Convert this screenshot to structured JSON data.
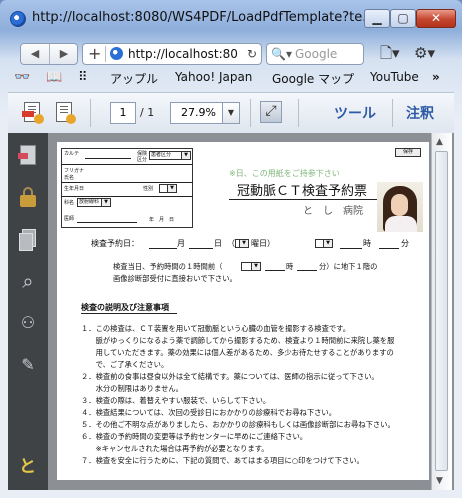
{
  "window": {
    "title": "http://localhost:8080/WS4PDF/LoadPdfTemplate?te..."
  },
  "address_bar": {
    "url": "http://localhost:80"
  },
  "search": {
    "placeholder": "Google"
  },
  "bookmarks": [
    "アップル",
    "Yahoo! Japan",
    "Google マップ",
    "YouTube"
  ],
  "pdf_toolbar": {
    "page_current": "1",
    "page_total": "/ 1",
    "zoom": "27.9%",
    "tools_label": "ツール",
    "comment_label": "注釈"
  },
  "sidebar": {
    "bottom_char": "と"
  },
  "document": {
    "form_labels": {
      "karte": "カルテ",
      "hoken_kind": "保険",
      "kubun": "区分",
      "furigana": "フリガナ",
      "name": "氏名",
      "birthday": "生年月日",
      "gender": "性別",
      "ward": "科名",
      "doctor": "医師",
      "date_suffix": "年　月　日",
      "hoken_value": "患者区分",
      "ward_value": "放射線科"
    },
    "stamp_label": "保存",
    "faint_note": "※日、この用紙をご持参下さい",
    "title": "冠動脈ＣＴ検査予約票",
    "hospital": "と　し　病院",
    "reservation": {
      "label": "検査予約日：",
      "month": "月",
      "day": "日",
      "weekday_open": "（",
      "weekday_close": "曜日）",
      "hour": "時",
      "minute": "分"
    },
    "arrival": {
      "line1_before": "検査当日、予約時間の１時間前（",
      "line1_hour": "時",
      "line1_after": "分）に地下１階の",
      "line2": "画像診断部受付に直接おいで下さい。"
    },
    "section_heading": "検査の説明及び注意事項",
    "items": [
      "１．この検査は、ＣＴ装置を用いて冠動脈という心臓の血管を撮影する検査です。",
      "　　脈がゆっくりになるよう薬で調節してから撮影するため、検査より１時間前に来院し薬を服",
      "　　用していただきます。薬の効果には個人差があるため、多少お待たせすることがありますの",
      "　　で、ご了承ください。",
      "２．検査前の食事は昼食以外は全て結構です。薬については、医師の指示に従って下さい。",
      "　　水分の制限はありません。",
      "３．検査の際は、着替えやすい服装で、いらして下さい。",
      "４．検査結果については、次回の受診日におかかりの診療科でお尋ね下さい。",
      "５．その他ご不明な点がありましたら、おかかりの診療科もしくは画像診断部にお尋ね下さい。",
      "６．検査の予約時間の変更等は予約センターに早めにご連絡下さい。",
      "　　※キャンセルされた場合は再予約が必要となります。",
      "７．検査を安全に行うために、下記の質問で、あてはまる項目に○印をつけて下さい。"
    ]
  }
}
